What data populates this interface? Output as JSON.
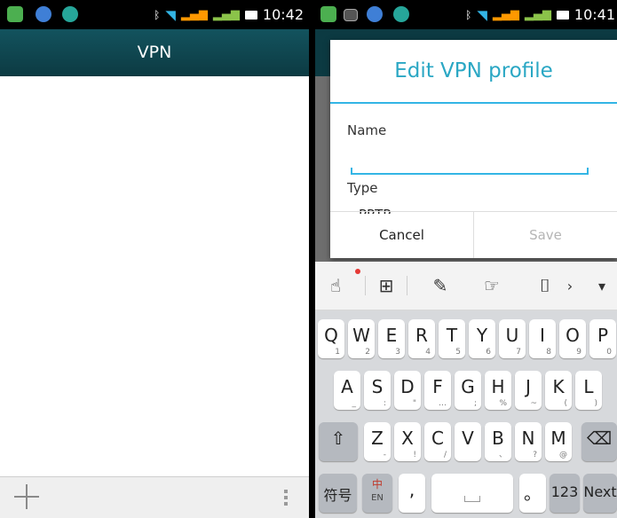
{
  "left": {
    "status_time": "10:42",
    "title": "VPN"
  },
  "right": {
    "status_time": "10:41",
    "dialog": {
      "title": "Edit VPN profile",
      "name_label": "Name",
      "name_value": "",
      "type_label": "Type",
      "type_value": "PPTP",
      "cancel": "Cancel",
      "save": "Save"
    },
    "toolbar_icons": [
      "gesture-hand-icon",
      "grid-keyboard-icon",
      "edit-note-icon",
      "touch-hand-icon",
      "clipboard-icon",
      "chevron-right-icon",
      "chevron-down-icon"
    ],
    "keyboard": {
      "row1": [
        {
          "k": "Q",
          "s": "1"
        },
        {
          "k": "W",
          "s": "2"
        },
        {
          "k": "E",
          "s": "3"
        },
        {
          "k": "R",
          "s": "4"
        },
        {
          "k": "T",
          "s": "5"
        },
        {
          "k": "Y",
          "s": "6"
        },
        {
          "k": "U",
          "s": "7"
        },
        {
          "k": "I",
          "s": "8"
        },
        {
          "k": "O",
          "s": "9"
        },
        {
          "k": "P",
          "s": "0"
        }
      ],
      "row2": [
        {
          "k": "A",
          "s": "_"
        },
        {
          "k": "S",
          "s": ":"
        },
        {
          "k": "D",
          "s": "\""
        },
        {
          "k": "F",
          "s": "…"
        },
        {
          "k": "G",
          "s": ";"
        },
        {
          "k": "H",
          "s": "%"
        },
        {
          "k": "J",
          "s": "~"
        },
        {
          "k": "K",
          "s": "("
        },
        {
          "k": "L",
          "s": ")"
        }
      ],
      "row3": [
        {
          "k": "Z",
          "s": "-"
        },
        {
          "k": "X",
          "s": "!"
        },
        {
          "k": "C",
          "s": "/"
        },
        {
          "k": "V",
          "s": ""
        },
        {
          "k": "B",
          "s": "、"
        },
        {
          "k": "N",
          "s": "?"
        },
        {
          "k": "M",
          "s": "@"
        }
      ],
      "symbols_key": "符号",
      "lang_key_top": "中",
      "lang_key_bottom": "EN",
      "comma": ",",
      "period": "。",
      "num_key": "123",
      "next_key": "Next"
    }
  }
}
